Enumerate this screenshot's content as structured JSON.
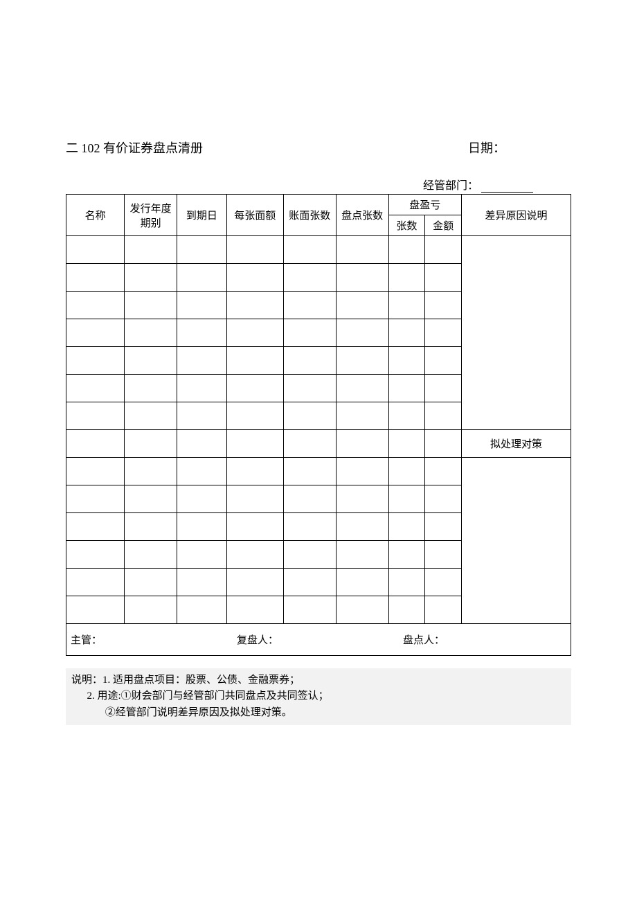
{
  "header": {
    "title": "二 102 有价证券盘点清册",
    "date_label": "日期：",
    "dept_label": "经管部门："
  },
  "columns": {
    "name": "名称",
    "issue_period": "发行年度期别",
    "due_date": "到期日",
    "face_value": "每张面额",
    "book_count": "账面张数",
    "actual_count": "盘点张数",
    "gain_loss": "盘盈亏",
    "gl_count": "张数",
    "gl_amount": "金额",
    "variance_reason": "差异原因说明",
    "countermeasure": "拟处理对策"
  },
  "signatures": {
    "supervisor": "主管：",
    "reviewer": "复盘人：",
    "counter": "盘点人："
  },
  "notes": {
    "line1": "说明：1. 适用盘点项目：股票、公债、金融票券；",
    "line2": "      2. 用途:①财会部门与经管部门共同盘点及共同签认；",
    "line3": "             ②经管部门说明差异原因及拟处理对策。"
  }
}
